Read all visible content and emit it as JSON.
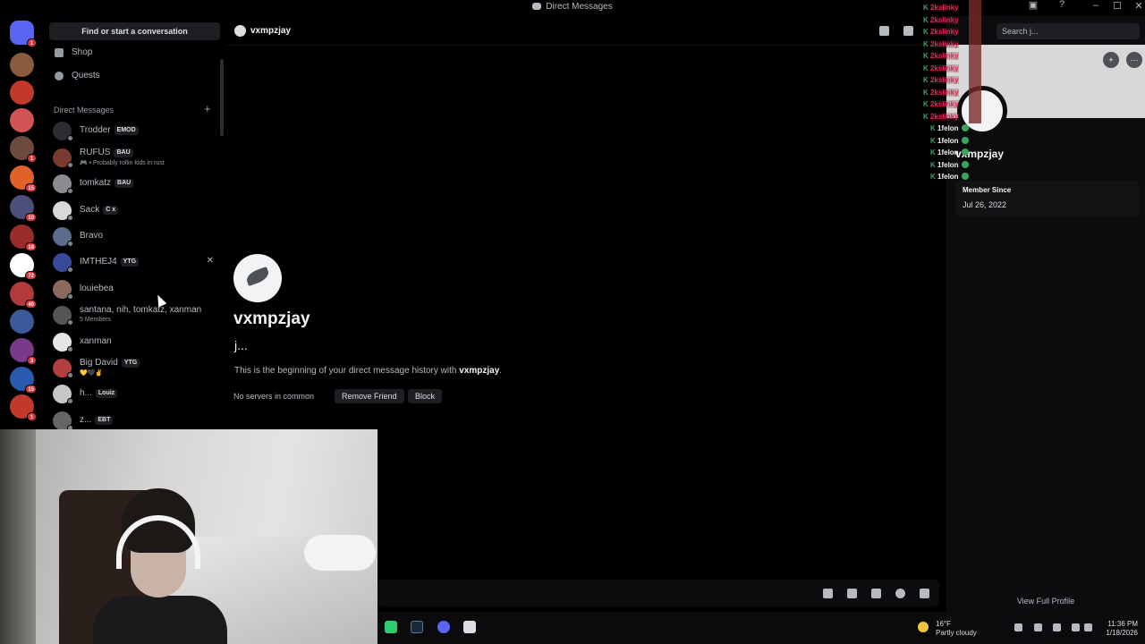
{
  "window": {
    "title": "Direct Messages",
    "controls": [
      "–",
      "☐",
      "✕"
    ]
  },
  "servers": [
    {
      "name": "discord-home",
      "color": "#5865f2",
      "badge": "1"
    },
    {
      "name": "server-1",
      "color": "#8a5a3c",
      "badge": ""
    },
    {
      "name": "server-2",
      "color": "#c0392b",
      "badge": ""
    },
    {
      "name": "server-3",
      "color": "#d35454",
      "badge": ""
    },
    {
      "name": "server-4",
      "color": "#6b4b3e",
      "badge": "1"
    },
    {
      "name": "server-5",
      "color": "#e0622a",
      "badge": "15"
    },
    {
      "name": "server-6",
      "color": "#4b4f7a",
      "badge": "10"
    },
    {
      "name": "server-7",
      "color": "#9b2c2c",
      "badge": "18"
    },
    {
      "name": "server-8",
      "color": "#ffffff",
      "badge": "72"
    },
    {
      "name": "server-9",
      "color": "#b13b3b",
      "badge": "40"
    },
    {
      "name": "server-10",
      "color": "#3a5a9a",
      "badge": ""
    },
    {
      "name": "server-11",
      "color": "#7a3a8a",
      "badge": "3"
    },
    {
      "name": "server-12",
      "color": "#2a5ab0",
      "badge": "15"
    },
    {
      "name": "server-13",
      "color": "#c0392b",
      "badge": "1"
    }
  ],
  "sidebar": {
    "find_label": "Find or start a conversation",
    "nav": [
      {
        "label": "Shop"
      },
      {
        "label": "Quests"
      }
    ],
    "dm_header": "Direct Messages",
    "dm_add": "+",
    "dms": [
      {
        "name": "Trodder",
        "tag": "EMOD",
        "sub": "",
        "avatar": "#2b2d31"
      },
      {
        "name": "RUFUS",
        "tag": "BAU",
        "sub": "🎮 • Probably rollin kids in rust",
        "avatar": "#7a3b2e"
      },
      {
        "name": "tomkatz",
        "tag": "BAU",
        "sub": "",
        "avatar": "#8a8c91"
      },
      {
        "name": "Sack",
        "tag": "C x",
        "sub": "",
        "avatar": "#d9d9d9"
      },
      {
        "name": "Bravo",
        "tag": "",
        "sub": "",
        "avatar": "#5b6b8c"
      },
      {
        "name": "IMTHEJ4",
        "tag": "YTG",
        "sub": "",
        "avatar": "#3a4a9a"
      },
      {
        "name": "louiebea",
        "tag": "",
        "sub": "",
        "avatar": "#8a6a5a"
      },
      {
        "name": "santana, nih, tomkatz, xanman",
        "tag": "",
        "sub": "5 Members",
        "avatar": "#555"
      },
      {
        "name": "xanman",
        "tag": "",
        "sub": "",
        "avatar": "#e5e5e5"
      },
      {
        "name": "Big David",
        "tag": "YTG",
        "sub": "💛🖤✌",
        "avatar": "#b34040"
      },
      {
        "name": "h...",
        "tag": "Louiz",
        "sub": "",
        "avatar": "#c7c7c7"
      },
      {
        "name": "z...",
        "tag": "EBT",
        "sub": "",
        "avatar": "#666"
      }
    ],
    "close_glyph": "✕"
  },
  "chat": {
    "header_name": "vxmpzjay",
    "profile_name": "vxmpzjay",
    "profile_sub": "j...",
    "begin_prefix": "This is the beginning of your direct message history with ",
    "begin_name": "vxmpzjay",
    "begin_suffix": ".",
    "no_servers": "No servers in common",
    "remove_friend": "Remove Friend",
    "block": "Block"
  },
  "right_panel": {
    "search_placeholder": "Search j...",
    "name": "vxmpzjay",
    "member_since_label": "Member Since",
    "member_since": "Jul 26, 2022",
    "view_full_profile": "View Full Profile",
    "more_glyph": "···",
    "add_friend_glyph": "+"
  },
  "overlay": {
    "red_rows": [
      "2kslinky",
      "2kslinky",
      "2kslinky",
      "2kslinky",
      "2kslinky",
      "2kslinky",
      "2kslinky",
      "2kslinky",
      "2kslinky",
      "2kslinky"
    ],
    "green_rows": [
      "1felon",
      "1felon",
      "1felon",
      "1felon",
      "1felon"
    ],
    "k_glyph": "K"
  },
  "taskbar": {
    "weather_temp": "16°F",
    "weather_desc": "Partly cloudy",
    "time": "11:36 PM",
    "date": "1/18/2026"
  }
}
